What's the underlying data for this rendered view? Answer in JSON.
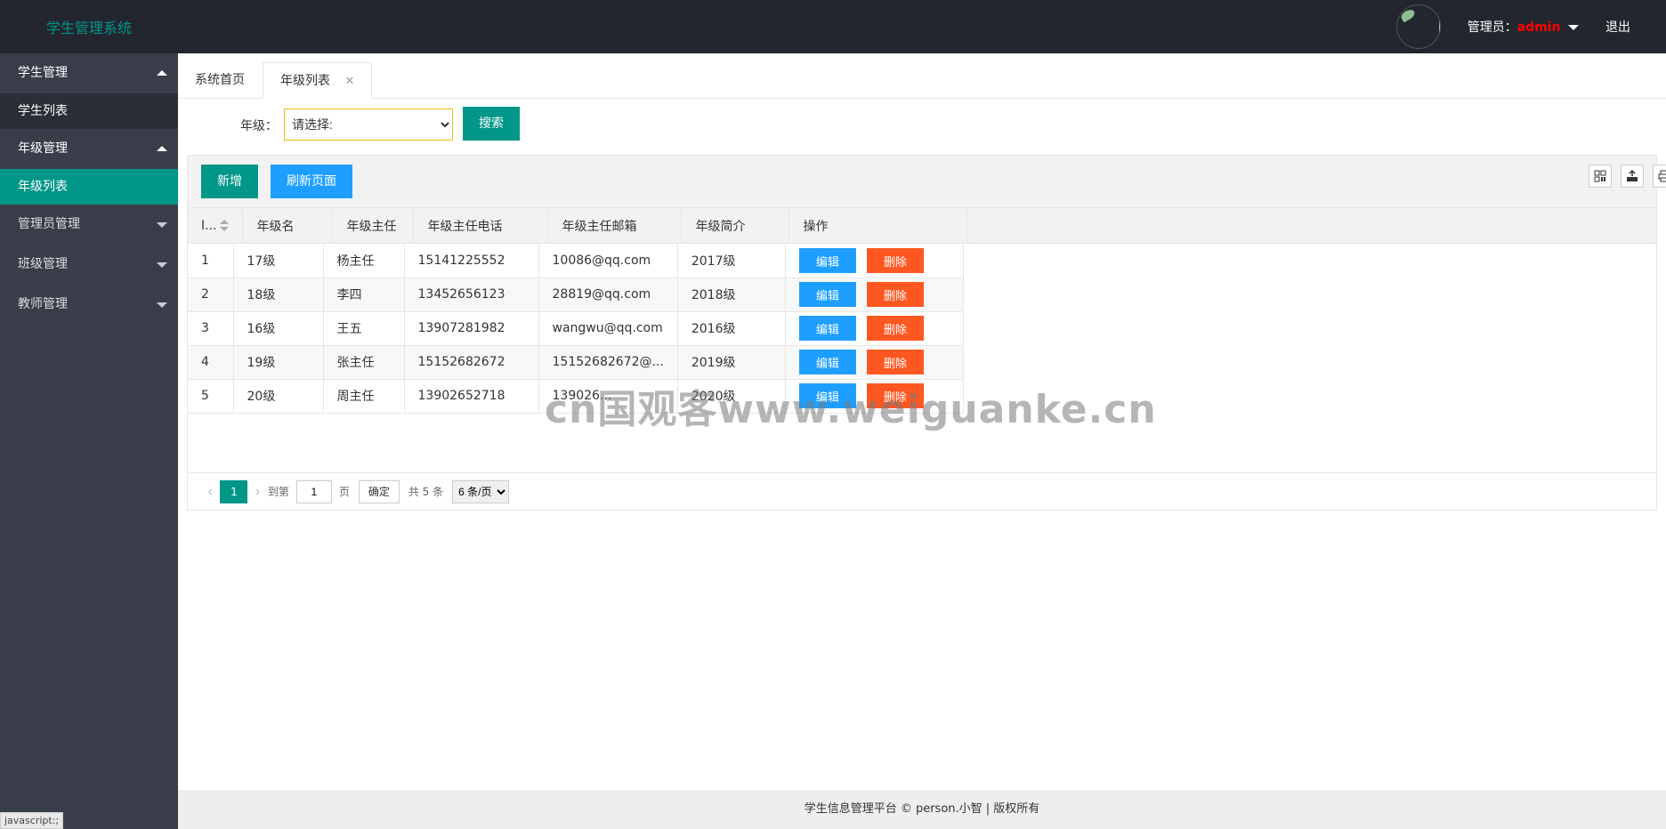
{
  "header": {
    "logo": "学生管理系统",
    "admin_prefix": "管理员：",
    "admin_name": "admin",
    "logout": "退出"
  },
  "sidebar": {
    "groups": [
      {
        "label": "学生管理",
        "expanded": true,
        "items": [
          {
            "label": "学生列表",
            "active": false
          }
        ]
      },
      {
        "label": "年级管理",
        "expanded": true,
        "items": [
          {
            "label": "年级列表",
            "active": true
          }
        ]
      },
      {
        "label": "管理员管理",
        "expanded": false,
        "items": []
      },
      {
        "label": "班级管理",
        "expanded": false,
        "items": []
      },
      {
        "label": "教师管理",
        "expanded": false,
        "items": []
      }
    ],
    "status_tip": "javascript:;"
  },
  "tabs": [
    {
      "label": "系统首页",
      "active": false
    },
    {
      "label": "年级列表",
      "active": true,
      "close": "✕"
    }
  ],
  "search": {
    "label": "年级：",
    "select_value": "请选择:",
    "button": "搜索"
  },
  "toolbar": {
    "add": "新增",
    "refresh": "刷新页面",
    "icons": [
      "columns-icon",
      "export-icon",
      "print-icon"
    ]
  },
  "table": {
    "columns": [
      "I...",
      "年级名",
      "年级主任",
      "年级主任电话",
      "年级主任邮箱",
      "年级简介",
      "操作"
    ],
    "rows": [
      {
        "id": "1",
        "name": "17级",
        "head": "杨主任",
        "phone": "15141225552",
        "email": "10086@qq.com",
        "intro": "2017级"
      },
      {
        "id": "2",
        "name": "18级",
        "head": "李四",
        "phone": "13452656123",
        "email": "28819@qq.com",
        "intro": "2018级"
      },
      {
        "id": "3",
        "name": "16级",
        "head": "王五",
        "phone": "13907281982",
        "email": "wangwu@qq.com",
        "intro": "2016级"
      },
      {
        "id": "4",
        "name": "19级",
        "head": "张主任",
        "phone": "15152682672",
        "email": "15152682672@...",
        "intro": "2019级"
      },
      {
        "id": "5",
        "name": "20级",
        "head": "周主任",
        "phone": "13902652718",
        "email": "139026...",
        "intro": "2020级"
      }
    ],
    "edit_label": "编辑",
    "delete_label": "删除"
  },
  "pager": {
    "prev": "‹",
    "current": "1",
    "next": "›",
    "goto_prefix": "到第",
    "goto_value": "1",
    "goto_suffix": "页",
    "confirm": "确定",
    "total": "共 5 条",
    "page_size": "6 条/页"
  },
  "watermark": "cn国观客www.weiguanke.cn",
  "footer": "学生信息管理平台 © person.小智 | 版权所有"
}
